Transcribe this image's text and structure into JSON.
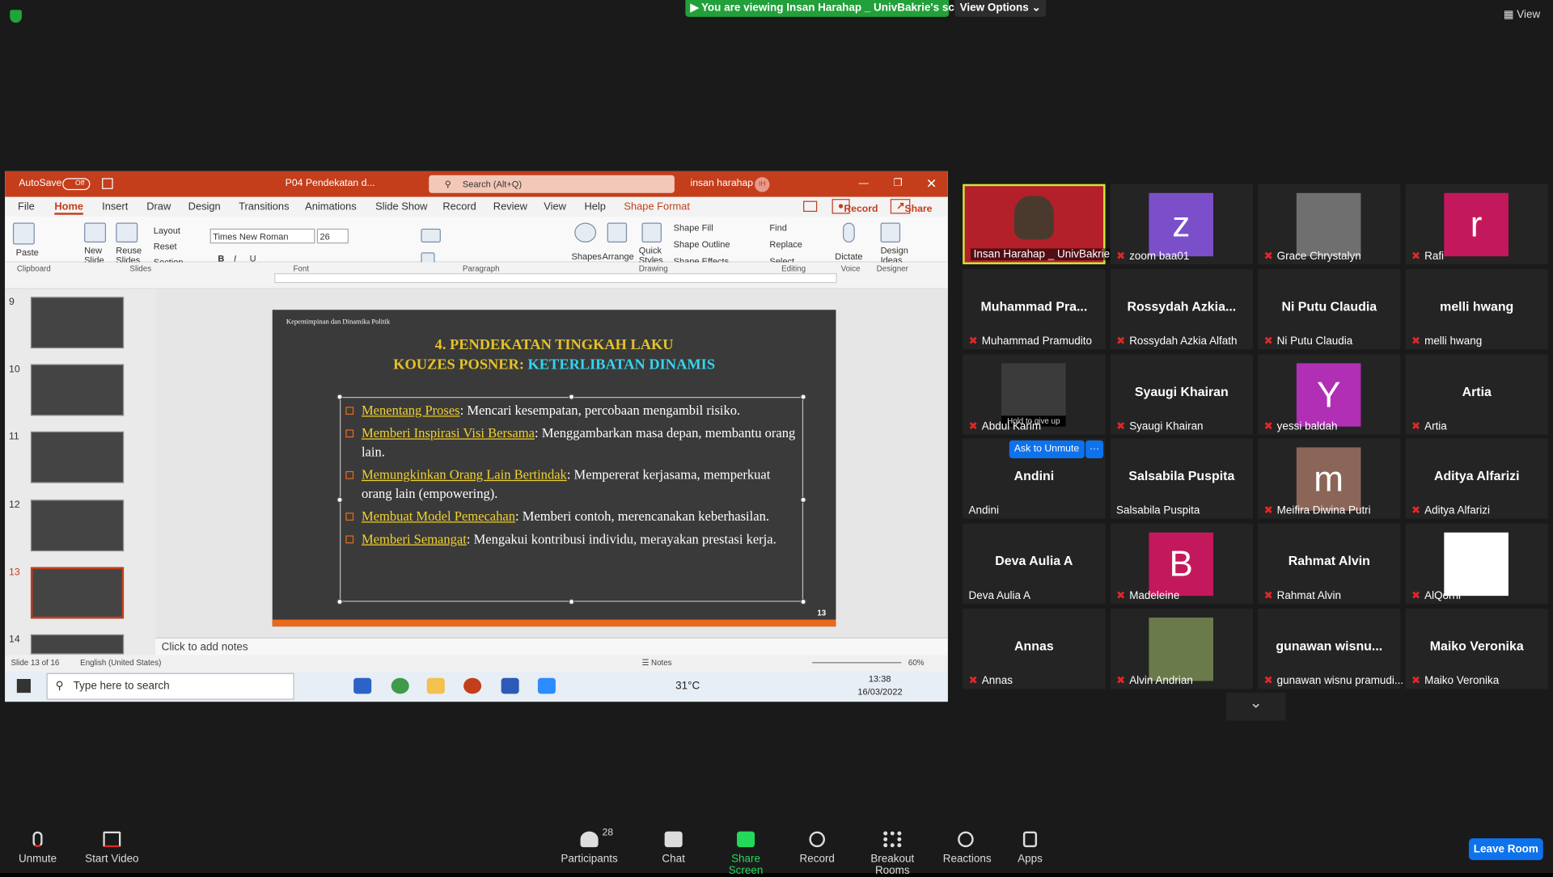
{
  "top": {
    "banner": "You are viewing Insan Harahap _ UnivBakrie's screen",
    "view_options": "View Options",
    "view": "View"
  },
  "ppt": {
    "autosave": "AutoSave",
    "off": "Off",
    "file_name": "P04 Pendekatan d...",
    "search": "Search (Alt+Q)",
    "user": "insan harahap",
    "user_initials": "IH",
    "tabs": [
      "File",
      "Home",
      "Insert",
      "Draw",
      "Design",
      "Transitions",
      "Animations",
      "Slide Show",
      "Record",
      "Review",
      "View",
      "Help",
      "Shape Format"
    ],
    "record_btn": "Record",
    "share_btn": "Share",
    "ribbon": {
      "paste": "Paste",
      "new_slide": "New Slide",
      "reuse_slides": "Reuse Slides",
      "layout": "Layout",
      "reset": "Reset",
      "section": "Section",
      "font_name": "Times New Roman",
      "font_size": "26",
      "shapes": "Shapes",
      "arrange": "Arrange",
      "quick_styles": "Quick Styles",
      "shape_fill": "Shape Fill",
      "shape_outline": "Shape Outline",
      "shape_effects": "Shape Effects",
      "find": "Find",
      "replace": "Replace",
      "select": "Select",
      "dictate": "Dictate",
      "design_ideas": "Design Ideas",
      "groups": [
        "Clipboard",
        "Slides",
        "Font",
        "Paragraph",
        "Drawing",
        "Editing",
        "Voice",
        "Designer"
      ]
    },
    "thumb_numbers": [
      "9",
      "10",
      "11",
      "12",
      "13",
      "14"
    ],
    "slide": {
      "header": "Kepemimpinan dan Dinamika Politik",
      "title1": "4. PENDEKATAN TINGKAH LAKU",
      "title2a": "KOUZES POSNER:",
      "title2b": "KETERLIBATAN DINAMIS",
      "page": "13",
      "bullets": [
        {
          "k": "Menentang Proses",
          "v": ": Mencari kesempatan, percobaan mengambil risiko."
        },
        {
          "k": "Memberi Inspirasi Visi Bersama",
          "v": ": Menggambarkan masa depan, membantu orang lain."
        },
        {
          "k": "Memungkinkan Orang Lain Bertindak",
          "v": ": Mempererat kerjasama, memperkuat orang lain (empowering)."
        },
        {
          "k": "Membuat Model Pemecahan",
          "v": ": Memberi contoh, merencanakan keberhasilan."
        },
        {
          "k": "Memberi Semangat",
          "v": ": Mengakui kontribusi individu, merayakan prestasi kerja."
        }
      ]
    },
    "notes": "Click to add notes",
    "status_slide": "Slide 13 of 16",
    "status_lang": "English (United States)",
    "notes_btn": "Notes",
    "zoom": "60%",
    "taskbar": {
      "search": "Type here to search",
      "temp": "31°C",
      "time": "13:38",
      "date": "16/03/2022"
    }
  },
  "tiles": [
    {
      "big": "",
      "name": "Insan Harahap _ UnivBakrie",
      "muted": false,
      "type": "video1"
    },
    {
      "big": "z",
      "name": "zoom baa01",
      "muted": true,
      "type": "avatar",
      "color": "#7b4fc9"
    },
    {
      "big": "",
      "name": "Grace Chrystalyn",
      "muted": true,
      "type": "photo"
    },
    {
      "big": "r",
      "name": "Rafi",
      "muted": true,
      "type": "avatar",
      "color": "#c4185c"
    },
    {
      "big": "Muhammad  Pra...",
      "name": "Muhammad Pramudito",
      "muted": true,
      "type": "text"
    },
    {
      "big": "Rossydah  Azkia...",
      "name": "Rossydah Azkia Alfath",
      "muted": true,
      "type": "text"
    },
    {
      "big": "Ni Putu Claudia",
      "name": "Ni Putu Claudia",
      "muted": true,
      "type": "text"
    },
    {
      "big": "melli hwang",
      "name": "melli hwang",
      "muted": true,
      "type": "text"
    },
    {
      "big": "",
      "name": "Abdul Karim",
      "muted": true,
      "type": "badge",
      "hold": "Hold",
      "give": "to give up"
    },
    {
      "big": "Syaugi Khairan",
      "name": "Syaugi Khairan",
      "muted": true,
      "type": "text"
    },
    {
      "big": "Y",
      "name": "yessi baldah",
      "muted": true,
      "type": "avatar",
      "color": "#b02fb5"
    },
    {
      "big": "Artia",
      "name": "Artia",
      "muted": true,
      "type": "text"
    },
    {
      "big": "Andini",
      "name": "Andini",
      "muted": false,
      "type": "text",
      "ask": "Ask to Unmute"
    },
    {
      "big": "Salsabila Puspita",
      "name": "Salsabila Puspita",
      "muted": false,
      "type": "text"
    },
    {
      "big": "m",
      "name": "Meifira Diwina Putri",
      "muted": true,
      "type": "avatar",
      "color": "#8b6658"
    },
    {
      "big": "Aditya Alfarizi",
      "name": "Aditya Alfarizi",
      "muted": true,
      "type": "text"
    },
    {
      "big": "Deva Aulia A",
      "name": "Deva Aulia A",
      "muted": false,
      "type": "text"
    },
    {
      "big": "B",
      "name": "Madeleine",
      "muted": true,
      "type": "avatar",
      "color": "#c4185c"
    },
    {
      "big": "Rahmat Alvin",
      "name": "Rahmat Alvin",
      "muted": true,
      "type": "text"
    },
    {
      "big": "",
      "name": "AlQorni",
      "muted": true,
      "type": "white"
    },
    {
      "big": "Annas",
      "name": "Annas",
      "muted": true,
      "type": "text"
    },
    {
      "big": "",
      "name": "Alvin Andrian",
      "muted": true,
      "type": "photo2"
    },
    {
      "big": "gunawan  wisnu...",
      "name": "gunawan wisnu pramudi...",
      "muted": true,
      "type": "text"
    },
    {
      "big": "Maiko Veronika",
      "name": "Maiko Veronika",
      "muted": true,
      "type": "text"
    }
  ],
  "bottom": {
    "unmute": "Unmute",
    "start_video": "Start Video",
    "participants": "Participants",
    "participants_count": "28",
    "chat": "Chat",
    "share_screen": "Share Screen",
    "record": "Record",
    "breakout": "Breakout Rooms",
    "reactions": "Reactions",
    "apps": "Apps",
    "leave": "Leave Room"
  }
}
